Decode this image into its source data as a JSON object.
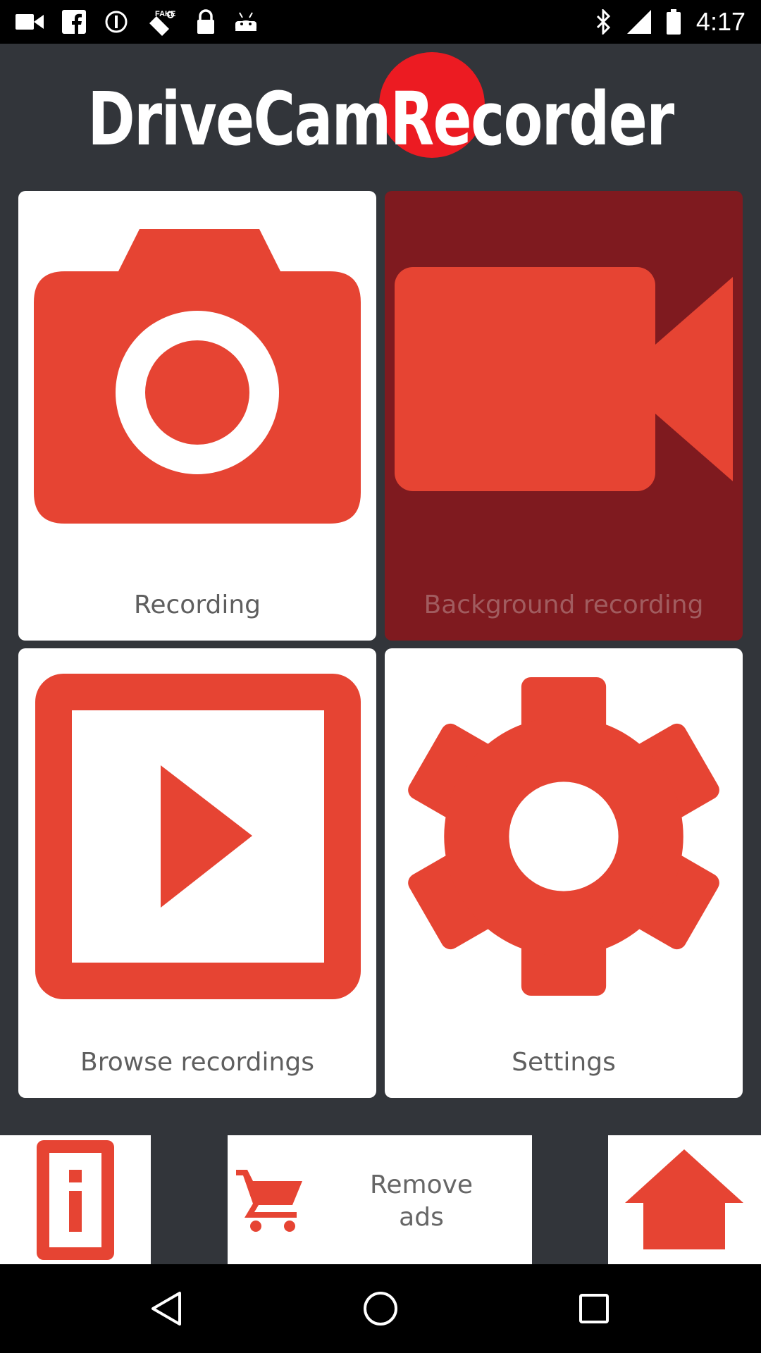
{
  "status_bar": {
    "time": "4:17",
    "left_icons": [
      "video-camera-icon",
      "facebook-icon",
      "sync-icon",
      "fake-gps-icon",
      "lock-icon",
      "android-icon"
    ],
    "right_icons": [
      "bluetooth-icon",
      "signal-icon",
      "battery-icon"
    ]
  },
  "header": {
    "logo_text": "DriveCamRecorder"
  },
  "tiles": [
    {
      "label": "Recording",
      "icon": "camera-icon"
    },
    {
      "label": "Background recording",
      "icon": "video-camera-icon"
    },
    {
      "label": "Browse recordings",
      "icon": "play-icon"
    },
    {
      "label": "Settings",
      "icon": "gear-icon"
    }
  ],
  "bottom_bar": {
    "info_icon": "info-icon",
    "remove_ads_line1": "Remove",
    "remove_ads_line2": "ads",
    "cart_icon": "cart-icon",
    "home_icon": "home-icon"
  },
  "nav_bar": {
    "buttons": [
      "back-icon",
      "home-circle-icon",
      "recents-icon"
    ]
  },
  "colors": {
    "accent": "#e64433",
    "background": "#32353a",
    "selected_tile": "#7f1a1f",
    "logo_dot": "#ec1b22"
  }
}
